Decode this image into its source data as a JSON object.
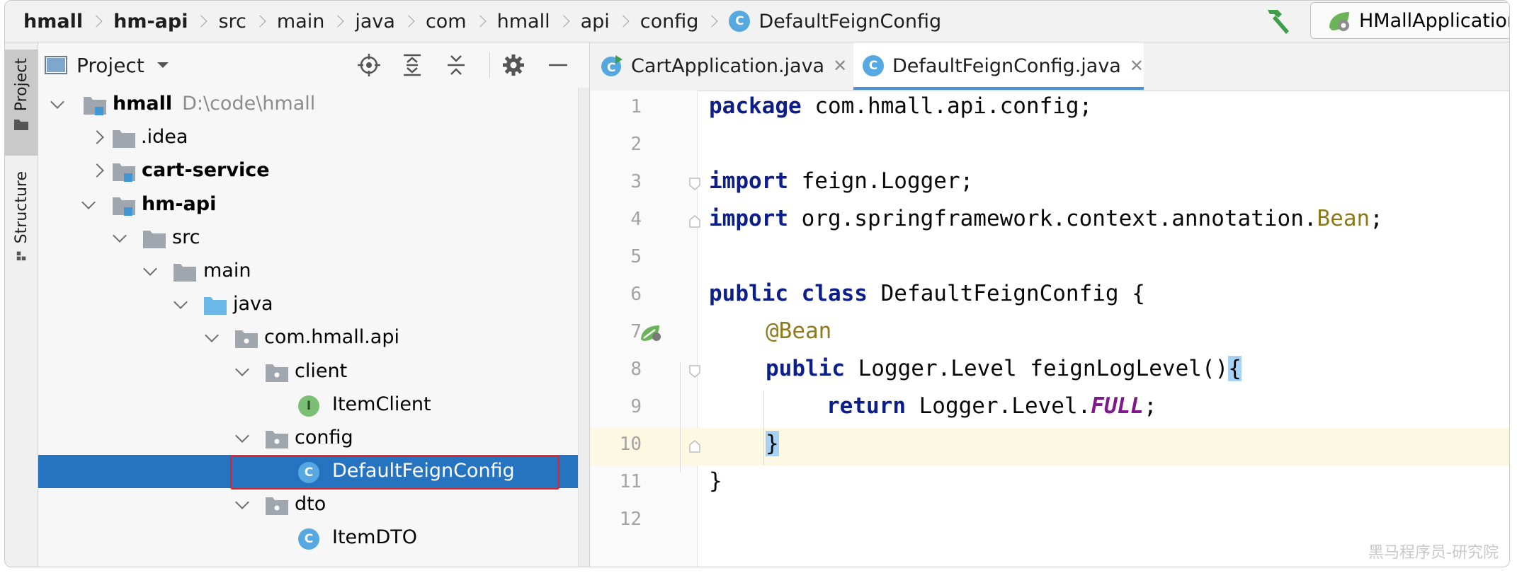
{
  "breadcrumb": {
    "items": [
      {
        "label": "hmall",
        "bold": true
      },
      {
        "label": "hm-api",
        "bold": true
      },
      {
        "label": "src"
      },
      {
        "label": "main"
      },
      {
        "label": "java"
      },
      {
        "label": "com"
      },
      {
        "label": "hmall"
      },
      {
        "label": "api"
      },
      {
        "label": "config"
      }
    ],
    "file": "DefaultFeignConfig",
    "file_badge": "C"
  },
  "toolbar": {
    "build_icon": "hammer-icon",
    "run_config_label": "HMallApplication"
  },
  "side_stripe": {
    "project_tab": "Project",
    "structure_tab": "Structure"
  },
  "project_panel": {
    "title": "Project",
    "toolbar_icons": [
      "locate-icon",
      "expand-all-icon",
      "collapse-all-icon",
      "gear-icon",
      "minimize-icon"
    ],
    "tree": [
      {
        "label": "hmall",
        "extra": "D:\\code\\hmall",
        "icon": "module-icon",
        "expanded": true,
        "bold": true
      },
      {
        "label": ".idea",
        "icon": "folder-icon",
        "expanded": false
      },
      {
        "label": "cart-service",
        "icon": "module-icon",
        "expanded": false,
        "bold": true
      },
      {
        "label": "hm-api",
        "icon": "module-icon",
        "expanded": true,
        "bold": true
      },
      {
        "label": "src",
        "icon": "folder-icon",
        "expanded": true
      },
      {
        "label": "main",
        "icon": "folder-icon",
        "expanded": true
      },
      {
        "label": "java",
        "icon": "source-folder-icon",
        "expanded": true
      },
      {
        "label": "com.hmall.api",
        "icon": "package-icon",
        "expanded": true
      },
      {
        "label": "client",
        "icon": "package-icon",
        "expanded": true
      },
      {
        "label": "ItemClient",
        "icon": "interface-icon",
        "badge": "I"
      },
      {
        "label": "config",
        "icon": "package-icon",
        "expanded": true
      },
      {
        "label": "DefaultFeignConfig",
        "icon": "class-icon",
        "badge": "C",
        "selected": true
      },
      {
        "label": "dto",
        "icon": "package-icon",
        "expanded": true
      },
      {
        "label": "ItemDTO",
        "icon": "class-icon",
        "badge": "C"
      }
    ]
  },
  "editor": {
    "tabs": [
      {
        "label": "CartApplication.java",
        "active": false
      },
      {
        "label": "DefaultFeignConfig.java",
        "active": true
      }
    ],
    "current_line": 10,
    "lines": [
      {
        "n": "1"
      },
      {
        "n": "2"
      },
      {
        "n": "3"
      },
      {
        "n": "4"
      },
      {
        "n": "5"
      },
      {
        "n": "6"
      },
      {
        "n": "7"
      },
      {
        "n": "8"
      },
      {
        "n": "9"
      },
      {
        "n": "10"
      },
      {
        "n": "11"
      },
      {
        "n": "12"
      }
    ],
    "code": {
      "l1_kw": "package",
      "l1_rest": " com.hmall.api.config;",
      "l3_kw": "import",
      "l3_rest": " feign.Logger;",
      "l4_kw": "import",
      "l4_rest": " org.springframework.context.annotation.",
      "l4_cls": "Bean",
      "l4_end": ";",
      "l6_kw": "public class",
      "l6_rest": " DefaultFeignConfig {",
      "l7_ann": "@Bean",
      "l8_kw": "public",
      "l8_rest": " Logger.Level feignLogLevel()",
      "l8_brace": "{",
      "l9_kw": "return",
      "l9_rest": " Logger.Level.",
      "l9_fld": "FULL",
      "l9_end": ";",
      "l10_brace": "}",
      "l11": "}"
    }
  },
  "watermark": "黑马程序员-研究院"
}
